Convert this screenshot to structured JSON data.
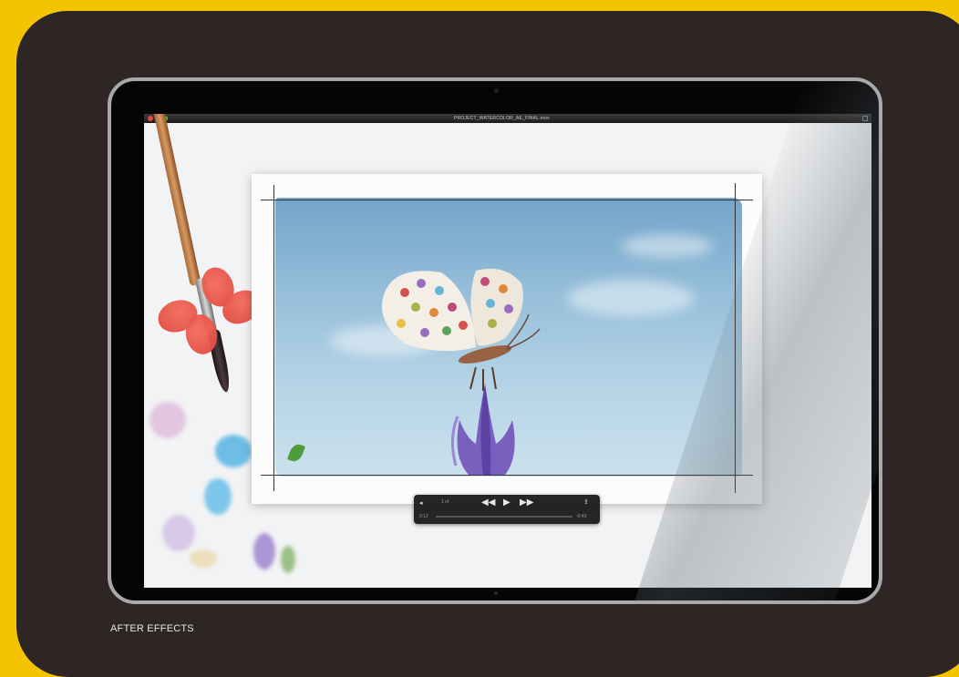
{
  "caption": "AFTER EFFECTS",
  "window": {
    "title": "PROJECT_WATERCOLOR_AE_FINAL.mov"
  },
  "player": {
    "current_time": "0:12",
    "remaining_time": "-0:43",
    "chapter": "1 of",
    "volume_icon": "speaker-icon",
    "rewind_icon": "rewind-icon",
    "play_icon": "play-icon",
    "forward_icon": "fast-forward-icon",
    "share_icon": "share-icon"
  },
  "colors": {
    "background": "#f5c400",
    "card": "#2e2624",
    "monitor_bezel": "#050505",
    "sky": "#93c0de"
  }
}
